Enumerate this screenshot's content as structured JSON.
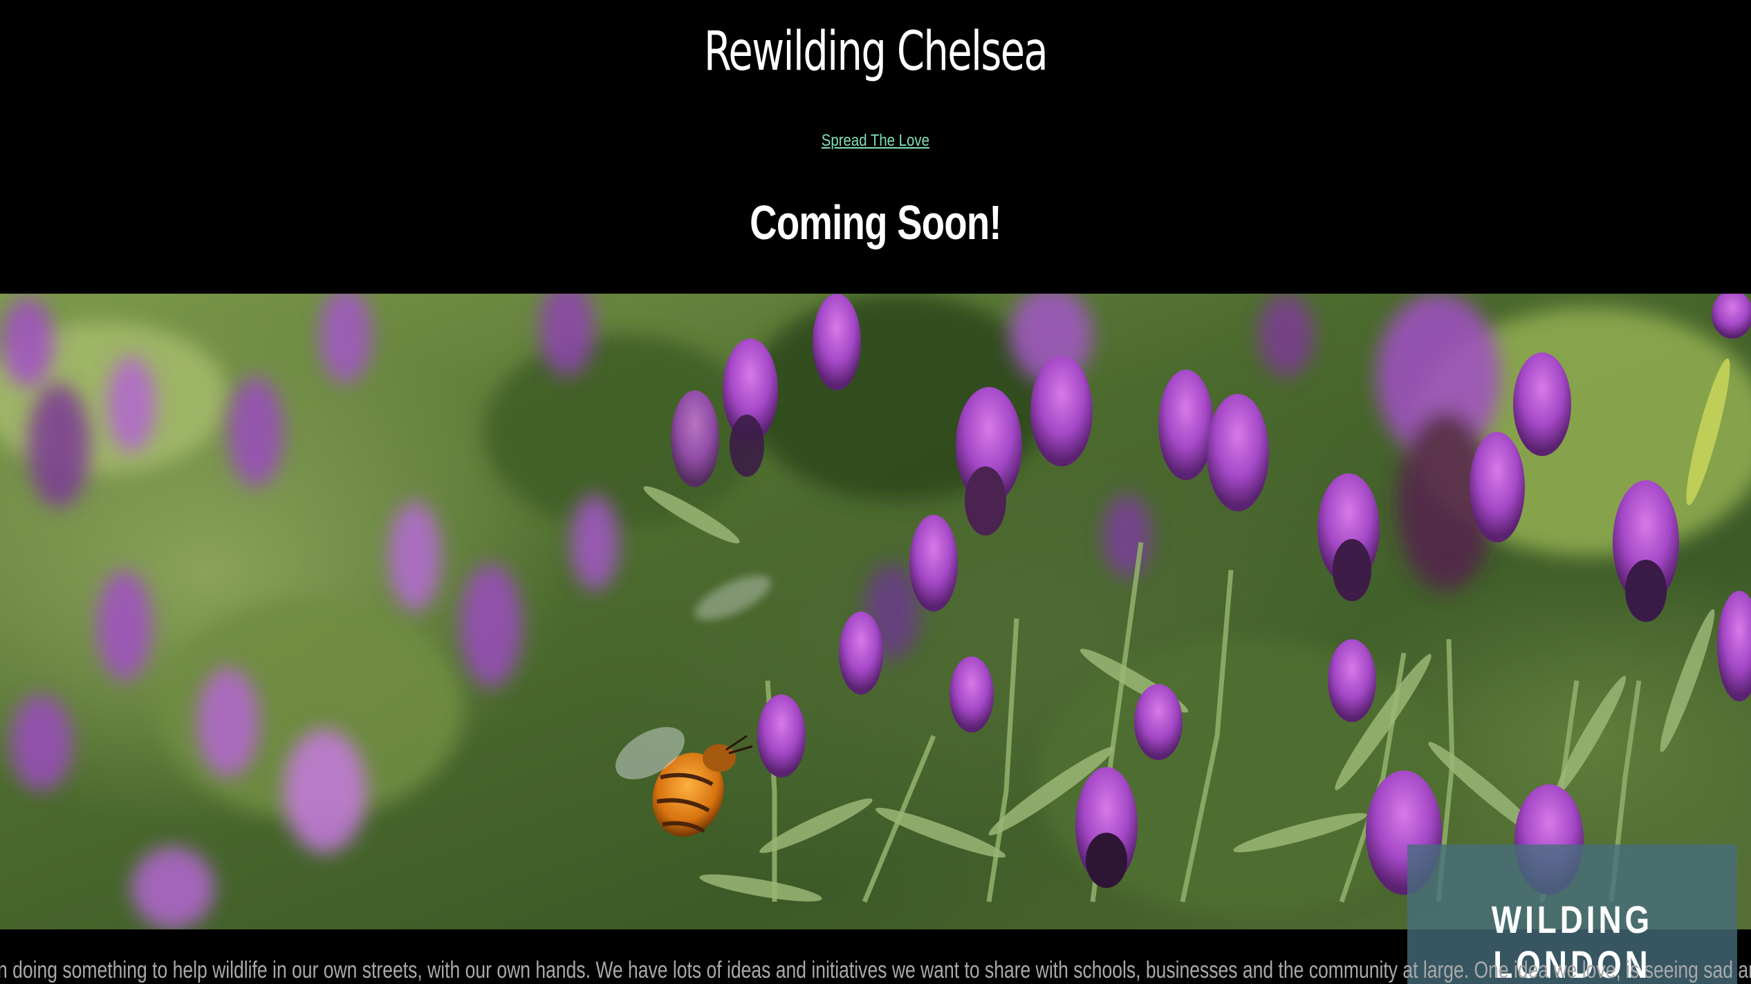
{
  "header": {
    "title": "Rewilding Chelsea",
    "link_label": "Spread The Love",
    "subtitle": "Coming Soon!"
  },
  "hero": {
    "image_description_icon": "lavender-bee-photo"
  },
  "badge": {
    "label": "WILDING LONDON"
  },
  "body": {
    "text": "n doing something to help wildlife in our own streets, with our own hands. We have lots of ideas and initiatives we want to share with schools, businesses and the community at large. One idea we love, is seeing sad and"
  },
  "colors": {
    "background": "#000000",
    "link": "#7fe0b6",
    "badge_bg": "#466e7d",
    "body_text": "#a9a9a9"
  }
}
